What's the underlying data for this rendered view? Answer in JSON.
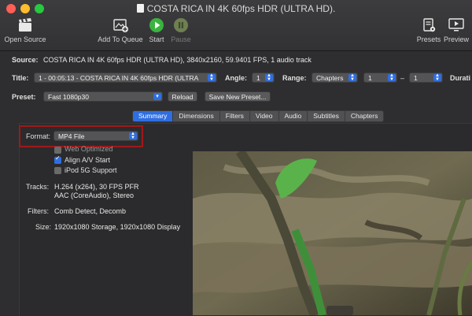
{
  "window": {
    "title": "COSTA RICA IN 4K 60fps HDR (ULTRA HD)."
  },
  "toolbar": {
    "open_source": "Open Source",
    "add_to_queue": "Add To Queue",
    "start": "Start",
    "pause": "Pause",
    "presets": "Presets",
    "preview": "Preview"
  },
  "source": {
    "label": "Source:",
    "value": "COSTA RICA IN 4K 60fps HDR (ULTRA HD), 3840x2160, 59.9401 FPS, 1 audio track"
  },
  "title_row": {
    "label": "Title:",
    "title_value": "1 - 00:05:13 - COSTA RICA IN 4K 60fps HDR (ULTRA",
    "angle_label": "Angle:",
    "angle_value": "1",
    "range_label": "Range:",
    "range_value": "Chapters",
    "range_start": "1",
    "range_dash": "–",
    "range_end": "1",
    "duration_label": "Durati"
  },
  "preset_row": {
    "label": "Preset:",
    "value": "Fast 1080p30",
    "reload": "Reload",
    "save_new": "Save New Preset..."
  },
  "tabs": [
    {
      "label": "Summary"
    },
    {
      "label": "Dimensions"
    },
    {
      "label": "Filters"
    },
    {
      "label": "Video"
    },
    {
      "label": "Audio"
    },
    {
      "label": "Subtitles"
    },
    {
      "label": "Chapters"
    }
  ],
  "summary": {
    "format_label": "Format:",
    "format_value": "MP4 File",
    "web_optimized": "Web Optimized",
    "align_av": "Align A/V Start",
    "ipod": "iPod 5G Support",
    "tracks_label": "Tracks:",
    "tracks_line1": "H.264 (x264), 30 FPS PFR",
    "tracks_line2": "AAC (CoreAudio), Stereo",
    "filters_label": "Filters:",
    "filters_value": "Comb Detect, Decomb",
    "size_label": "Size:",
    "size_value": "1920x1080 Storage, 1920x1080 Display"
  },
  "colors": {
    "accent": "#2f6ee0",
    "highlight": "#a01818",
    "start_green": "#3bb33f"
  }
}
